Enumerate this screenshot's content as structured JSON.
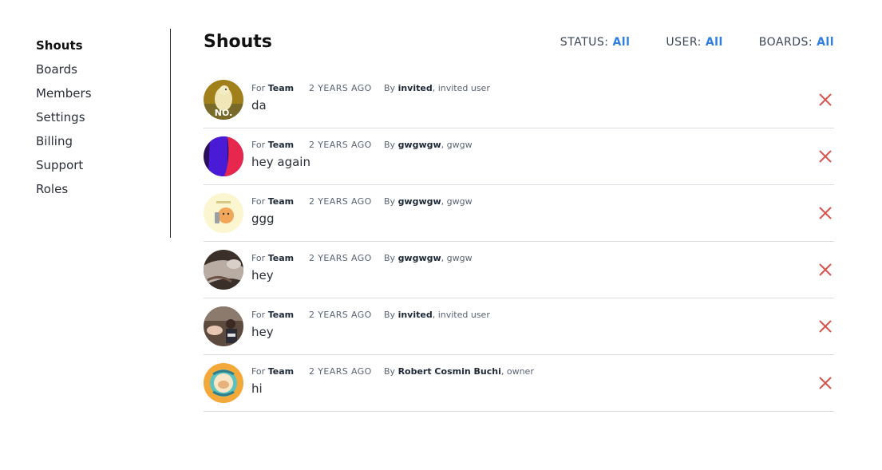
{
  "sidebar": {
    "items": [
      {
        "label": "Shouts"
      },
      {
        "label": "Boards"
      },
      {
        "label": "Members"
      },
      {
        "label": "Settings"
      },
      {
        "label": "Billing"
      },
      {
        "label": "Support"
      },
      {
        "label": "Roles"
      }
    ],
    "active": "Shouts"
  },
  "header": {
    "title": "Shouts",
    "filters": {
      "status_label": "STATUS:",
      "status_value": "All",
      "user_label": "USER:",
      "user_value": "All",
      "boards_label": "BOARDS:",
      "boards_value": "All"
    }
  },
  "shouts": [
    {
      "for_prefix": "For",
      "board": "Team",
      "time": "2 YEARS AGO",
      "by_prefix": "By",
      "user": "invited",
      "user_suffix": ", invited user",
      "message": "da",
      "avatar": "bird-no-avatar"
    },
    {
      "for_prefix": "For",
      "board": "Team",
      "time": "2 YEARS AGO",
      "by_prefix": "By",
      "user": "gwgwgw",
      "user_suffix": ", gwgw",
      "message": "hey again",
      "avatar": "blue-red-avatar"
    },
    {
      "for_prefix": "For",
      "board": "Team",
      "time": "2 YEARS AGO",
      "by_prefix": "By",
      "user": "gwgwgw",
      "user_suffix": ", gwgw",
      "message": "ggg",
      "avatar": "cartoon-avatar"
    },
    {
      "for_prefix": "For",
      "board": "Team",
      "time": "2 YEARS AGO",
      "by_prefix": "By",
      "user": "gwgwgw",
      "user_suffix": ", gwgw",
      "message": "hey",
      "avatar": "photo-avatar"
    },
    {
      "for_prefix": "For",
      "board": "Team",
      "time": "2 YEARS AGO",
      "by_prefix": "By",
      "user": "invited",
      "user_suffix": ", invited user",
      "message": "hey",
      "avatar": "people-photo-avatar"
    },
    {
      "for_prefix": "For",
      "board": "Team",
      "time": "2 YEARS AGO",
      "by_prefix": "By",
      "user": "Robert Cosmin Buchi",
      "user_suffix": ", owner",
      "message": "hi",
      "avatar": "sticker-avatar"
    }
  ],
  "colors": {
    "accent": "#2f7fe0",
    "delete": "#d9534f",
    "divider": "#dadde2"
  },
  "icons": {
    "delete": "close-icon"
  }
}
